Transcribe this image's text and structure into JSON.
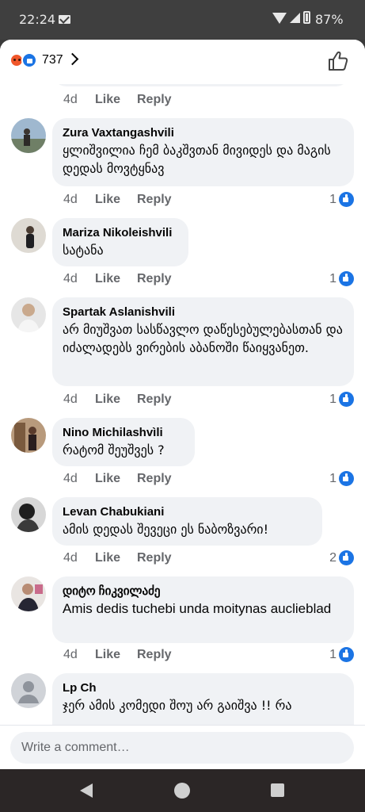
{
  "status_bar": {
    "time": "22:24",
    "battery": "87%",
    "icons": [
      "mail-icon",
      "wifi-icon",
      "signal-icon",
      "battery-icon"
    ]
  },
  "header": {
    "reactions": [
      "angry-reaction-icon",
      "like-reaction-icon"
    ],
    "reaction_count": "737",
    "chevron": "chevron-right-icon",
    "like_icon": "thumbs-up-outline-icon"
  },
  "actions": {
    "like": "Like",
    "reply": "Reply"
  },
  "partial_comment": {
    "time": "4d"
  },
  "comments": [
    {
      "author": "Zura Vaxtangashvili",
      "text": "ყლიშვილია ჩემ ბაკშვთან მივიდეს და მაგის დედას მოვტყნავ",
      "time": "4d",
      "likes": "1"
    },
    {
      "author": "Mariza Nikoleishvili",
      "text": "სატანა",
      "time": "4d",
      "likes": "1"
    },
    {
      "author": "Spartak Aslanishvili",
      "text": "არ მიუშვათ სასწავლო დაწესებულებასთან და იძალადებს ვირების აბანოში წაიყვანეთ.",
      "time": "4d",
      "likes": "1"
    },
    {
      "author": "Nino Michilashvìli",
      "text": "რატომ შეუშვეს ?",
      "time": "4d",
      "likes": "1"
    },
    {
      "author": "Levan Chabukiani",
      "text": "ამის დედას შევეცი ეს  ნაბოზვარი!",
      "time": "4d",
      "likes": "2"
    },
    {
      "author": "დიტო ჩიკვილაძე",
      "text": "Amis dedis tuchebi unda moitynas auclieblad",
      "time": "4d",
      "likes": "1"
    },
    {
      "author": "Lp Ch",
      "text": "ჯერ ამის კომედი შოუ არ გაიშვა !! რა"
    }
  ],
  "composer": {
    "placeholder": "Write a comment…"
  },
  "nav_bar": {
    "buttons": [
      "back-button",
      "home-button",
      "recents-button"
    ]
  },
  "colors": {
    "accent": "#1b74e4",
    "bubble": "#f0f2f5",
    "secondary_text": "#65676b",
    "angry": "#f0572b"
  }
}
